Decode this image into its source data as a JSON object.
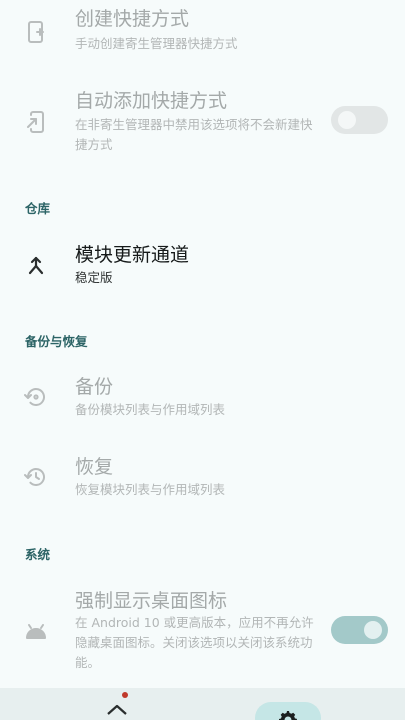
{
  "settings": {
    "create_shortcut": {
      "title": "创建快捷方式",
      "subtitle": "手动创建寄生管理器快捷方式",
      "icon": "shortcut-add-icon"
    },
    "auto_add_shortcut": {
      "title": "自动添加快捷方式",
      "subtitle": "在非寄生管理器中禁用该选项将不会新建快捷方式",
      "icon": "phone-arrow-icon",
      "switch_on": false
    },
    "repository": {
      "header": "仓库",
      "update_channel": {
        "title": "模块更新通道",
        "subtitle": "稳定版",
        "icon": "merge-arrow-icon"
      }
    },
    "backup_restore": {
      "header": "备份与恢复",
      "backup": {
        "title": "备份",
        "subtitle": "备份模块列表与作用域列表",
        "icon": "backup-restore-icon"
      },
      "restore": {
        "title": "恢复",
        "subtitle": "恢复模块列表与作用域列表",
        "icon": "history-icon"
      }
    },
    "system": {
      "header": "系统",
      "force_desktop_icon": {
        "title": "强制显示桌面图标",
        "subtitle": "在 Android 10 或更高版本，应用不再允许隐藏桌面图标。关闭该选项以关闭该系统功能。",
        "icon": "android-icon",
        "switch_on": true
      }
    }
  },
  "bottom_nav": {
    "items": [
      {
        "icon": "home-icon",
        "badge": true
      },
      {
        "icon": "gear-icon",
        "selected": true
      }
    ]
  },
  "colors": {
    "accent": "#2c6466",
    "background": "#f6fbfb",
    "switch_on": "#a3c9c9"
  }
}
